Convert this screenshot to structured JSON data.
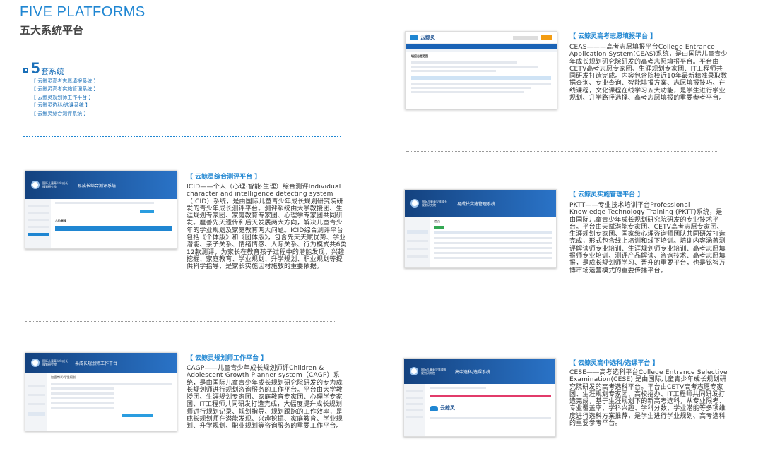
{
  "header": {
    "title_en": "FIVE PLATFORMS",
    "title_cn": "五大系统平台"
  },
  "systems": {
    "count": "5",
    "suffix": "套系统",
    "items": [
      "【 云鲸灵高考志愿填报系统 】",
      "【 云鲸灵高考实施管理系统 】",
      "【 云鲸灵规划师工作平台 】",
      "【 云鲸灵选科/选课系统 】",
      "【 云鲸灵综合测评系统 】"
    ]
  },
  "platforms": [
    {
      "title": "【 云鲸灵高考志愿填报平台 】",
      "desc": "CEAS———高考志愿填报平台College Entrance Application System(CEAS)系统，是由国际儿童青少年成长规划研究院研发的高考志愿填报平台。平台由CETV高考志愿专家团、生涯规划专家团、IT工程师共同研发打造完成。内容包含院校近10年最新精准录取数据查询、专业查询、智能填报方案、志愿填报技巧、在线课程，文化课程在线学习五大功能，是学生进行学业规划、升学路径选择、高考志愿填报的重要参考平台。",
      "shot": {
        "brand": "云鲸灵",
        "heading": "填报志愿范围"
      }
    },
    {
      "title": "【 云鲸灵综合测评平台 】",
      "desc": "ICID——个人（心理·智能·生理）综合测评Individual character and intelligence detecting system（ICID）系统，是由国际儿童青少年成长规划研究院研发的青少年成长测评平台。测评系统由大学教授团、生涯规划专家团、家庭教育专家团、心理学专家团共同研发。厘善先天遗传和后天发展两大方向，解决儿童青少年的学业规划及家庭教育两大问题。ICID综合测评平台包括《个体版》和《团体版》，包含先天天赋优势、学业潜能、亲子关系、情绪情感、人际关系、行为模式共6类12款测评，为家长在教育孩子过程中的潜能发现、兴趣挖掘、家庭教育、学业规划、升学规划、职业规划等提供科学指导，是家长实施因材施教的重要依据。",
      "shot": {
        "brand": "国际儿童青少年成长规划研究院",
        "system": "易成长综合测评系统",
        "section": "六边题模"
      }
    },
    {
      "title": "【 云鲸灵实施管理平台 】",
      "desc": "PKTT——专业技术培训平台Professional Knowledge Technology Training (PKTT)系统，是由国际儿童青少年成长规划研究院研发的专业技术平台。平台由天赋潜能专家团、CETV高考志愿专家团、生涯规划专家团、国家级心理咨询师团队共同研发打造完成，形式包含线上培训和线下培训。培训内容涵盖测评解读师专业培训、生涯规划师专业培训、高考志愿填报师专业培训、测评产品解读、咨询技术、高考志愿填报，是成长规划师学习、晋升的重要平台，也是铭智万博市场运营模式的重要传播平台。",
      "shot": {
        "brand": "国际儿童青少年成长规划研究院",
        "system": "易成长实施管理系统",
        "section": "首页"
      }
    },
    {
      "title": "【 云鲸灵规划师工作平台 】",
      "desc": "CAGP——儿童青少年成长规划师评Children & Adolescent Growth Planner system（CAGP）系统，是由国际儿童青少年成长规划研究院研发的专为成长规划师进行规划咨询服务的工作平台。平台由大学教授团、生涯规划专家团、家庭教育专家团、心理学专家团、IT工程师共同研发打造完成，大幅度提升成长规划师进行规划记录、规划指导、规划跟踪的工作效率，是成长规划师在潜能发现、兴趣挖掘、家庭教育、学业规划、升学规划、职业规划等咨询服务的重要工作平台。",
      "shot": {
        "brand": "国际儿童青少年成长规划研究院",
        "system": "易成长规划师工作平台",
        "section": "加盟商(0) 学生规划"
      }
    },
    {
      "title": "【 云鲸灵高中选科/选课平台 】",
      "desc": "CESE——高考选科平台College Entrance Selective Examination(CESE) 是由国际儿童青少年成长规划研究院研发的高考选科平台。平台由CETV高考志愿专家团、生涯规划专家团、高校招办、IT工程师共同研发打造完成，基于生涯规划下的新高考选科，从专业限考、专业覆盖率、学科兴趣、学科分数、学业潜能等多项维度进行选科方案推荐，是学生进行学业规划、高考选科的重要参考平台。",
      "shot": {
        "brand": "国际儿童青少年成长规划研究院",
        "system": "高中选科/选课系统",
        "logo": "云鲸灵"
      }
    }
  ]
}
